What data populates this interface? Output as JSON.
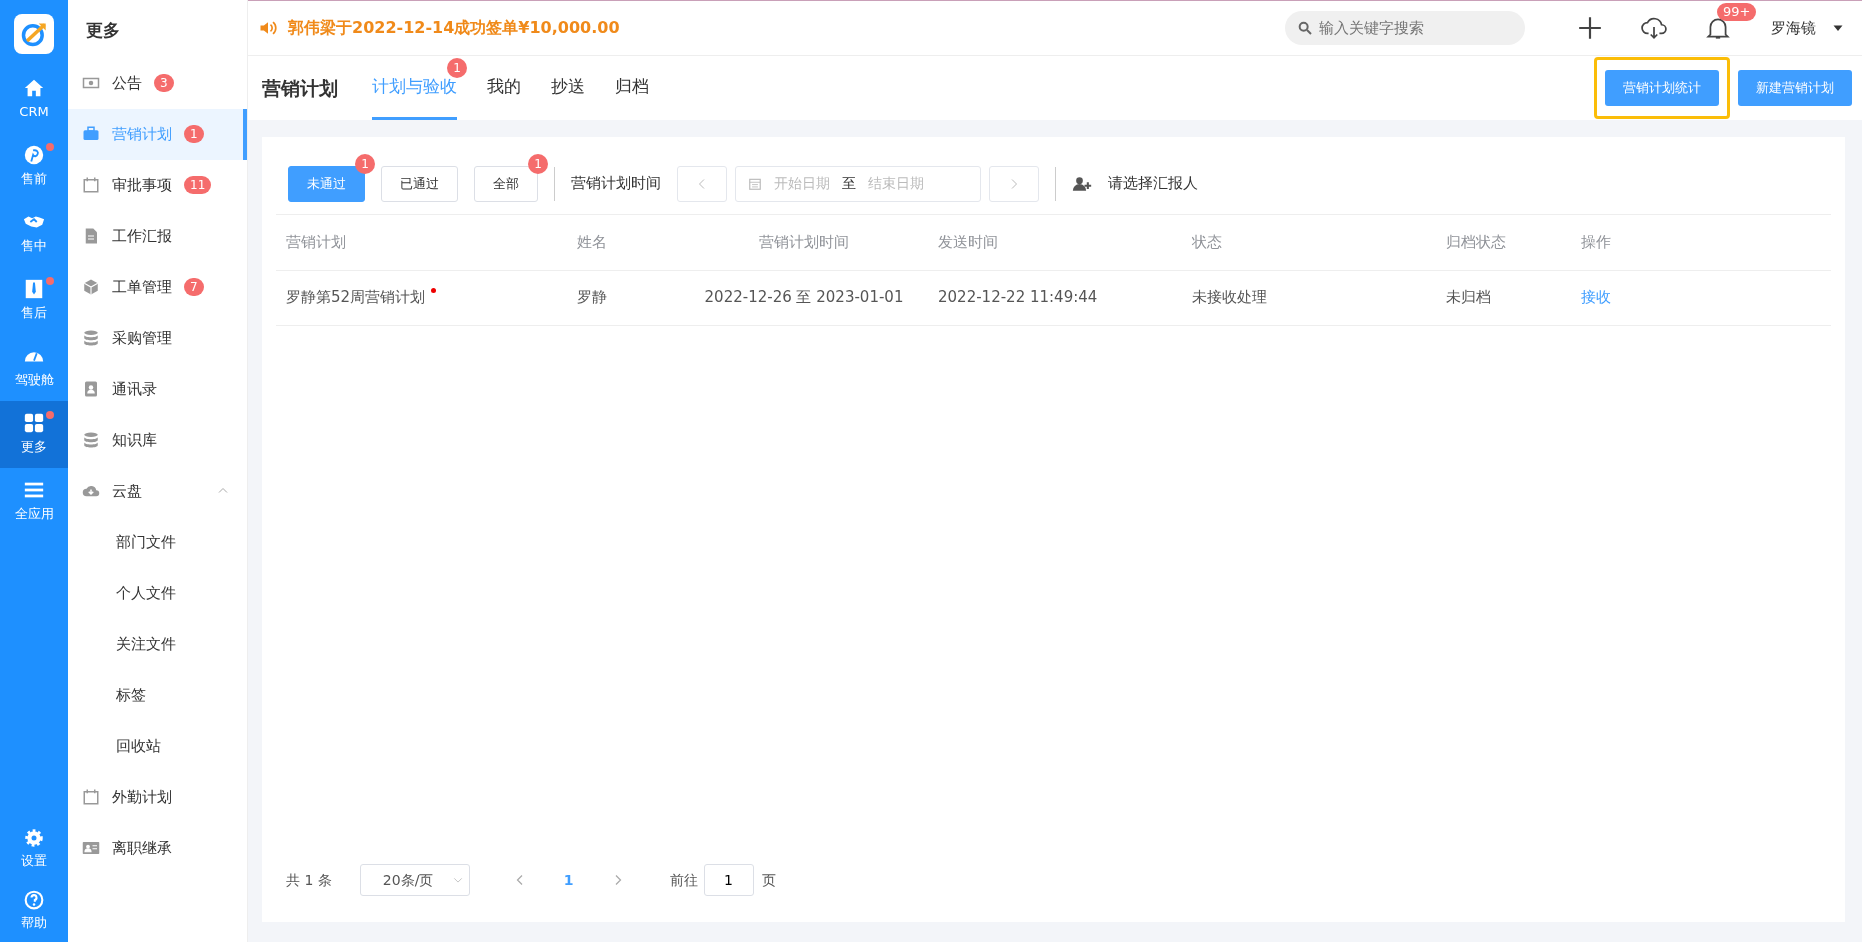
{
  "rail": {
    "items": [
      {
        "label": "CRM",
        "dot": false,
        "selected": false
      },
      {
        "label": "售前",
        "dot": true,
        "selected": false
      },
      {
        "label": "售中",
        "dot": false,
        "selected": false
      },
      {
        "label": "售后",
        "dot": true,
        "selected": false
      },
      {
        "label": "驾驶舱",
        "dot": false,
        "selected": false
      },
      {
        "label": "更多",
        "dot": true,
        "selected": true
      },
      {
        "label": "全应用",
        "dot": false,
        "selected": false
      }
    ],
    "bottom_items": [
      {
        "label": "设置"
      },
      {
        "label": "帮助"
      }
    ]
  },
  "sidebar": {
    "title": "更多",
    "items": [
      {
        "label": "公告",
        "badge": "3",
        "selected": false
      },
      {
        "label": "营销计划",
        "badge": "1",
        "selected": true
      },
      {
        "label": "审批事项",
        "badge": "11",
        "selected": false
      },
      {
        "label": "工作汇报",
        "selected": false
      },
      {
        "label": "工单管理",
        "badge": "7",
        "selected": false
      },
      {
        "label": "采购管理",
        "selected": false
      },
      {
        "label": "通讯录",
        "selected": false
      },
      {
        "label": "知识库",
        "selected": false
      },
      {
        "label": "云盘",
        "selected": false,
        "expanded": true,
        "children": [
          {
            "label": "部门文件",
            "selected": false
          },
          {
            "label": "个人文件",
            "selected": false
          },
          {
            "label": "关注文件",
            "selected": false
          },
          {
            "label": "标签",
            "selected": false
          },
          {
            "label": "回收站",
            "selected": false
          }
        ]
      },
      {
        "label": "外勤计划",
        "selected": false
      },
      {
        "label": "离职继承",
        "selected": false
      }
    ]
  },
  "topbar": {
    "notice": "郭伟梁于2022-12-14成功签单¥10,000.00",
    "search": {
      "placeholder": "输入关键字搜索"
    },
    "notifications_badge": "99+",
    "user": "罗海镜"
  },
  "header": {
    "title": "营销计划",
    "tabs": [
      {
        "label": "计划与验收",
        "badge": "1",
        "selected": true
      },
      {
        "label": "我的",
        "selected": false
      },
      {
        "label": "抄送",
        "selected": false
      },
      {
        "label": "归档",
        "selected": false
      }
    ],
    "buttons": [
      {
        "label": "营销计划统计",
        "highlighted": true
      },
      {
        "label": "新建营销计划",
        "highlighted": false
      }
    ]
  },
  "filters": {
    "status_buttons": [
      {
        "label": "未通过",
        "badge": "1",
        "selected": true
      },
      {
        "label": "已通过",
        "selected": false
      },
      {
        "label": "全部",
        "badge": "1",
        "selected": false
      }
    ],
    "date_label": "营销计划时间",
    "start_placeholder": "开始日期",
    "separator": "至",
    "end_placeholder": "结束日期",
    "reporter": "请选择汇报人"
  },
  "table": {
    "columns": [
      "营销计划",
      "姓名",
      "营销计划时间",
      "发送时间",
      "状态",
      "归档状态",
      "操作"
    ],
    "rows": [
      {
        "plan": "罗静第52周营销计划",
        "unread": true,
        "name": "罗静",
        "period": "2022-12-26 至 2023-01-01",
        "sent": "2022-12-22 11:49:44",
        "status": "未接收处理",
        "archive": "未归档",
        "action": "接收"
      }
    ]
  },
  "pagination": {
    "total": "共 1 条",
    "page_size": "20条/页",
    "current": "1",
    "goto_label": "前往",
    "goto_value": "1",
    "page_unit": "页"
  }
}
